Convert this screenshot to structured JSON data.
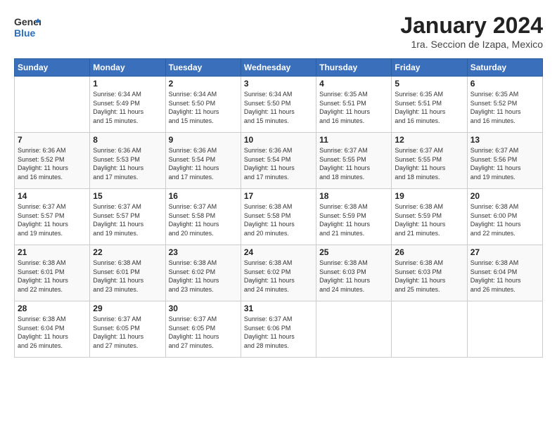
{
  "logo": {
    "general": "General",
    "blue": "Blue"
  },
  "title": "January 2024",
  "subtitle": "1ra. Seccion de Izapa, Mexico",
  "headers": [
    "Sunday",
    "Monday",
    "Tuesday",
    "Wednesday",
    "Thursday",
    "Friday",
    "Saturday"
  ],
  "weeks": [
    [
      {
        "num": "",
        "info": ""
      },
      {
        "num": "1",
        "info": "Sunrise: 6:34 AM\nSunset: 5:49 PM\nDaylight: 11 hours\nand 15 minutes."
      },
      {
        "num": "2",
        "info": "Sunrise: 6:34 AM\nSunset: 5:50 PM\nDaylight: 11 hours\nand 15 minutes."
      },
      {
        "num": "3",
        "info": "Sunrise: 6:34 AM\nSunset: 5:50 PM\nDaylight: 11 hours\nand 15 minutes."
      },
      {
        "num": "4",
        "info": "Sunrise: 6:35 AM\nSunset: 5:51 PM\nDaylight: 11 hours\nand 16 minutes."
      },
      {
        "num": "5",
        "info": "Sunrise: 6:35 AM\nSunset: 5:51 PM\nDaylight: 11 hours\nand 16 minutes."
      },
      {
        "num": "6",
        "info": "Sunrise: 6:35 AM\nSunset: 5:52 PM\nDaylight: 11 hours\nand 16 minutes."
      }
    ],
    [
      {
        "num": "7",
        "info": "Sunrise: 6:36 AM\nSunset: 5:52 PM\nDaylight: 11 hours\nand 16 minutes."
      },
      {
        "num": "8",
        "info": "Sunrise: 6:36 AM\nSunset: 5:53 PM\nDaylight: 11 hours\nand 17 minutes."
      },
      {
        "num": "9",
        "info": "Sunrise: 6:36 AM\nSunset: 5:54 PM\nDaylight: 11 hours\nand 17 minutes."
      },
      {
        "num": "10",
        "info": "Sunrise: 6:36 AM\nSunset: 5:54 PM\nDaylight: 11 hours\nand 17 minutes."
      },
      {
        "num": "11",
        "info": "Sunrise: 6:37 AM\nSunset: 5:55 PM\nDaylight: 11 hours\nand 18 minutes."
      },
      {
        "num": "12",
        "info": "Sunrise: 6:37 AM\nSunset: 5:55 PM\nDaylight: 11 hours\nand 18 minutes."
      },
      {
        "num": "13",
        "info": "Sunrise: 6:37 AM\nSunset: 5:56 PM\nDaylight: 11 hours\nand 19 minutes."
      }
    ],
    [
      {
        "num": "14",
        "info": "Sunrise: 6:37 AM\nSunset: 5:57 PM\nDaylight: 11 hours\nand 19 minutes."
      },
      {
        "num": "15",
        "info": "Sunrise: 6:37 AM\nSunset: 5:57 PM\nDaylight: 11 hours\nand 19 minutes."
      },
      {
        "num": "16",
        "info": "Sunrise: 6:37 AM\nSunset: 5:58 PM\nDaylight: 11 hours\nand 20 minutes."
      },
      {
        "num": "17",
        "info": "Sunrise: 6:38 AM\nSunset: 5:58 PM\nDaylight: 11 hours\nand 20 minutes."
      },
      {
        "num": "18",
        "info": "Sunrise: 6:38 AM\nSunset: 5:59 PM\nDaylight: 11 hours\nand 21 minutes."
      },
      {
        "num": "19",
        "info": "Sunrise: 6:38 AM\nSunset: 5:59 PM\nDaylight: 11 hours\nand 21 minutes."
      },
      {
        "num": "20",
        "info": "Sunrise: 6:38 AM\nSunset: 6:00 PM\nDaylight: 11 hours\nand 22 minutes."
      }
    ],
    [
      {
        "num": "21",
        "info": "Sunrise: 6:38 AM\nSunset: 6:01 PM\nDaylight: 11 hours\nand 22 minutes."
      },
      {
        "num": "22",
        "info": "Sunrise: 6:38 AM\nSunset: 6:01 PM\nDaylight: 11 hours\nand 23 minutes."
      },
      {
        "num": "23",
        "info": "Sunrise: 6:38 AM\nSunset: 6:02 PM\nDaylight: 11 hours\nand 23 minutes."
      },
      {
        "num": "24",
        "info": "Sunrise: 6:38 AM\nSunset: 6:02 PM\nDaylight: 11 hours\nand 24 minutes."
      },
      {
        "num": "25",
        "info": "Sunrise: 6:38 AM\nSunset: 6:03 PM\nDaylight: 11 hours\nand 24 minutes."
      },
      {
        "num": "26",
        "info": "Sunrise: 6:38 AM\nSunset: 6:03 PM\nDaylight: 11 hours\nand 25 minutes."
      },
      {
        "num": "27",
        "info": "Sunrise: 6:38 AM\nSunset: 6:04 PM\nDaylight: 11 hours\nand 26 minutes."
      }
    ],
    [
      {
        "num": "28",
        "info": "Sunrise: 6:38 AM\nSunset: 6:04 PM\nDaylight: 11 hours\nand 26 minutes."
      },
      {
        "num": "29",
        "info": "Sunrise: 6:37 AM\nSunset: 6:05 PM\nDaylight: 11 hours\nand 27 minutes."
      },
      {
        "num": "30",
        "info": "Sunrise: 6:37 AM\nSunset: 6:05 PM\nDaylight: 11 hours\nand 27 minutes."
      },
      {
        "num": "31",
        "info": "Sunrise: 6:37 AM\nSunset: 6:06 PM\nDaylight: 11 hours\nand 28 minutes."
      },
      {
        "num": "",
        "info": ""
      },
      {
        "num": "",
        "info": ""
      },
      {
        "num": "",
        "info": ""
      }
    ]
  ]
}
